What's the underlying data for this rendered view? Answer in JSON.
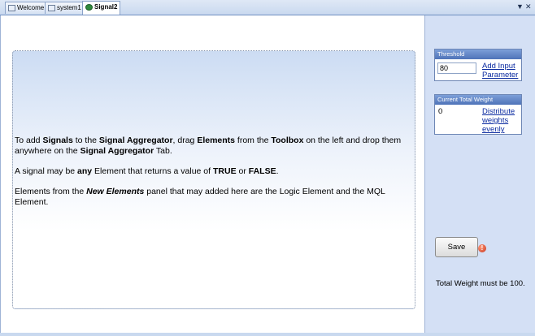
{
  "tabs": [
    {
      "label": "Welcome"
    },
    {
      "label": "system1"
    },
    {
      "label": "Signal2"
    }
  ],
  "strip": {
    "dropdown": "▼",
    "close": "✕"
  },
  "panel": {
    "p1": [
      {
        "t": "To add ",
        "s": "n"
      },
      {
        "t": "Signals",
        "s": "b"
      },
      {
        "t": " to the ",
        "s": "n"
      },
      {
        "t": "Signal Aggregator",
        "s": "b"
      },
      {
        "t": ", drag ",
        "s": "n"
      },
      {
        "t": "Elements",
        "s": "b"
      },
      {
        "t": " from the ",
        "s": "n"
      },
      {
        "t": "Toolbox",
        "s": "b"
      },
      {
        "t": " on the left and drop them anywhere on the ",
        "s": "n"
      },
      {
        "t": "Signal Aggregator",
        "s": "b"
      },
      {
        "t": " Tab.",
        "s": "n"
      }
    ],
    "p2": [
      {
        "t": "A signal may be ",
        "s": "n"
      },
      {
        "t": "any",
        "s": "b"
      },
      {
        "t": " Element that returns a value of ",
        "s": "n"
      },
      {
        "t": "TRUE",
        "s": "b"
      },
      {
        "t": " or ",
        "s": "n"
      },
      {
        "t": "FALSE",
        "s": "b"
      },
      {
        "t": ".",
        "s": "n"
      }
    ],
    "p3": [
      {
        "t": "Elements from the ",
        "s": "n"
      },
      {
        "t": "New Elements",
        "s": "bi"
      },
      {
        "t": " panel that may added here are the Logic Element and the MQL Element.",
        "s": "n"
      }
    ]
  },
  "side": {
    "threshold": {
      "header": "Threshold",
      "value": "80",
      "link": "Add Input Parameter"
    },
    "weight": {
      "header": "Current Total Weight",
      "value": "0",
      "link": "Distribute weights evenly"
    },
    "save_label": "Save",
    "error_glyph": "!",
    "message": "Total Weight must be 100."
  }
}
